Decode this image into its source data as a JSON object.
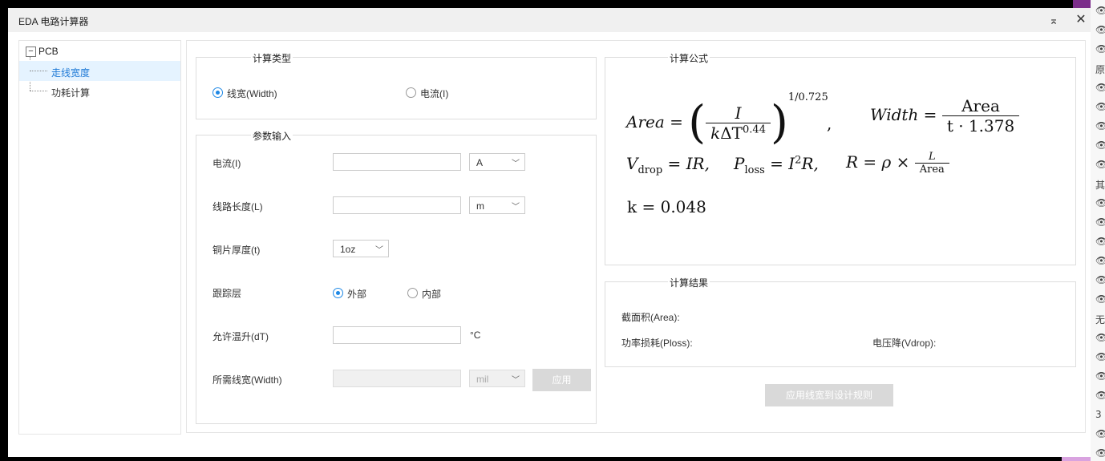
{
  "window": {
    "title": "EDA 电路计算器",
    "collapse_glyph": "⌅",
    "close_glyph": "✕"
  },
  "tree": {
    "root_label": "PCB",
    "toggle_glyph": "−",
    "items": [
      {
        "label": "走线宽度",
        "active": true
      },
      {
        "label": "功耗计算",
        "active": false
      }
    ]
  },
  "calc_type": {
    "title": "计算类型",
    "options": [
      {
        "label": "线宽(Width)",
        "checked": true
      },
      {
        "label": "电流(I)",
        "checked": false
      }
    ]
  },
  "params": {
    "title": "参数输入",
    "current": {
      "label": "电流(I)",
      "value": "",
      "unit": "A"
    },
    "length": {
      "label": "线路长度(L)",
      "value": "",
      "unit": "m"
    },
    "thickness": {
      "label": "铜片厚度(t)",
      "selected": "1oz"
    },
    "layer": {
      "label": "跟踪层",
      "options": [
        {
          "label": "外部",
          "checked": true
        },
        {
          "label": "内部",
          "checked": false
        }
      ]
    },
    "temp_rise": {
      "label": "允许温升(dT)",
      "value": "",
      "unit": "°C"
    },
    "width": {
      "label": "所需线宽(Width)",
      "value": "",
      "unit": "mil",
      "apply_label": "应用"
    }
  },
  "formula": {
    "title": "计算公式",
    "area_lhs": "Area",
    "area_num": "I",
    "area_den_k": "k",
    "area_den_dt": "ΔT",
    "area_den_exp": "0.44",
    "area_exp": "1/0.725",
    "width_lhs": "Width",
    "width_num": "Area",
    "width_den": "t · 1.378",
    "v_sym": "V",
    "v_sub": "drop",
    "v_rhs": "= IR,",
    "p_sym": "P",
    "p_sub": "loss",
    "p_rhs_i": "= I",
    "p_rhs_exp": "2",
    "p_rhs_r": "R,",
    "r_lhs": "R = ρ ×",
    "r_num": "L",
    "r_den": "Area",
    "k_line": "k = 0.048"
  },
  "results": {
    "title": "计算结果",
    "area_label": "截面积(Area):",
    "ploss_label": "功率损耗(Ploss):",
    "vdrop_label": "电压降(Vdrop):"
  },
  "apply_rule_button": "应用线宽到设计规则",
  "colors": {
    "accent": "#1e88e5",
    "tree_selected_bg": "#e5f3ff",
    "button_disabled": "#d9d9d9",
    "right_strip_top": "#7b2d8a",
    "right_strip_bottom": "#d9a3e0"
  },
  "side_strip": {
    "eye_glyph": "👁",
    "fragments": [
      "原",
      "其",
      "无",
      "3"
    ]
  }
}
